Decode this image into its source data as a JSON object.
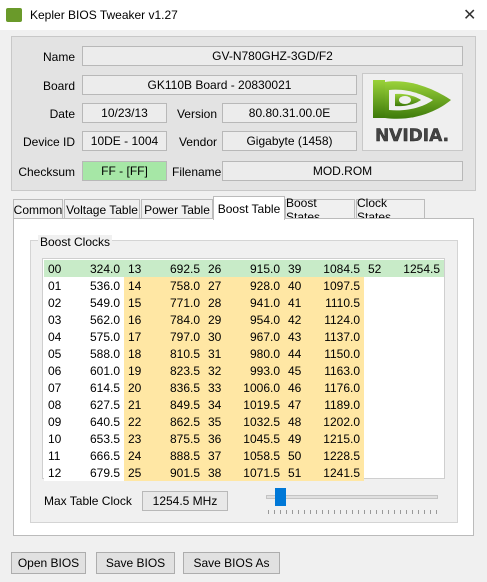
{
  "window": {
    "title": "Kepler BIOS Tweaker v1.27",
    "close_glyph": "✕"
  },
  "info": {
    "name_label": "Name",
    "name_value": "GV-N780GHZ-3GD/F2",
    "board_label": "Board",
    "board_value": "GK110B Board - 20830021",
    "date_label": "Date",
    "date_value": "10/23/13",
    "version_label": "Version",
    "version_value": "80.80.31.00.0E",
    "device_label": "Device ID",
    "device_value": "10DE - 1004",
    "vendor_label": "Vendor",
    "vendor_value": "Gigabyte (1458)",
    "checksum_label": "Checksum",
    "checksum_value": "FF - [FF]",
    "filename_label": "Filename",
    "filename_value": "MOD.ROM",
    "logo_text": "NVIDIA."
  },
  "tabs": [
    "Common",
    "Voltage Table",
    "Power Table",
    "Boost Table",
    "Boost States",
    "Clock States"
  ],
  "active_tab": 3,
  "boost": {
    "group_label": "Boost Clocks",
    "rows": [
      [
        [
          "00",
          "324.0"
        ],
        [
          "13",
          "692.5"
        ],
        [
          "26",
          "915.0"
        ],
        [
          "39",
          "1084.5"
        ],
        [
          "52",
          "1254.5"
        ]
      ],
      [
        [
          "01",
          "536.0"
        ],
        [
          "14",
          "758.0"
        ],
        [
          "27",
          "928.0"
        ],
        [
          "40",
          "1097.5"
        ]
      ],
      [
        [
          "02",
          "549.0"
        ],
        [
          "15",
          "771.0"
        ],
        [
          "28",
          "941.0"
        ],
        [
          "41",
          "1110.5"
        ]
      ],
      [
        [
          "03",
          "562.0"
        ],
        [
          "16",
          "784.0"
        ],
        [
          "29",
          "954.0"
        ],
        [
          "42",
          "1124.0"
        ]
      ],
      [
        [
          "04",
          "575.0"
        ],
        [
          "17",
          "797.0"
        ],
        [
          "30",
          "967.0"
        ],
        [
          "43",
          "1137.0"
        ]
      ],
      [
        [
          "05",
          "588.0"
        ],
        [
          "18",
          "810.5"
        ],
        [
          "31",
          "980.0"
        ],
        [
          "44",
          "1150.0"
        ]
      ],
      [
        [
          "06",
          "601.0"
        ],
        [
          "19",
          "823.5"
        ],
        [
          "32",
          "993.0"
        ],
        [
          "45",
          "1163.0"
        ]
      ],
      [
        [
          "07",
          "614.5"
        ],
        [
          "20",
          "836.5"
        ],
        [
          "33",
          "1006.0"
        ],
        [
          "46",
          "1176.0"
        ]
      ],
      [
        [
          "08",
          "627.5"
        ],
        [
          "21",
          "849.5"
        ],
        [
          "34",
          "1019.5"
        ],
        [
          "47",
          "1189.0"
        ]
      ],
      [
        [
          "09",
          "640.5"
        ],
        [
          "22",
          "862.5"
        ],
        [
          "35",
          "1032.5"
        ],
        [
          "48",
          "1202.0"
        ]
      ],
      [
        [
          "10",
          "653.5"
        ],
        [
          "23",
          "875.5"
        ],
        [
          "36",
          "1045.5"
        ],
        [
          "49",
          "1215.0"
        ]
      ],
      [
        [
          "11",
          "666.5"
        ],
        [
          "24",
          "888.5"
        ],
        [
          "37",
          "1058.5"
        ],
        [
          "50",
          "1228.5"
        ]
      ],
      [
        [
          "12",
          "679.5"
        ],
        [
          "25",
          "901.5"
        ],
        [
          "38",
          "1071.5"
        ],
        [
          "51",
          "1241.5"
        ]
      ]
    ],
    "max_label": "Max Table Clock",
    "max_value": "1254.5 MHz",
    "slider_level": 0.03
  },
  "buttons": {
    "open": "Open BIOS",
    "save": "Save BIOS",
    "save_as": "Save BIOS As"
  },
  "colors": {
    "highlight_row": "#c8ebc8",
    "boost_range": "#ffe7a4",
    "checksum_ok": "#a6e7a6",
    "nvidia_green": "#76b900"
  }
}
